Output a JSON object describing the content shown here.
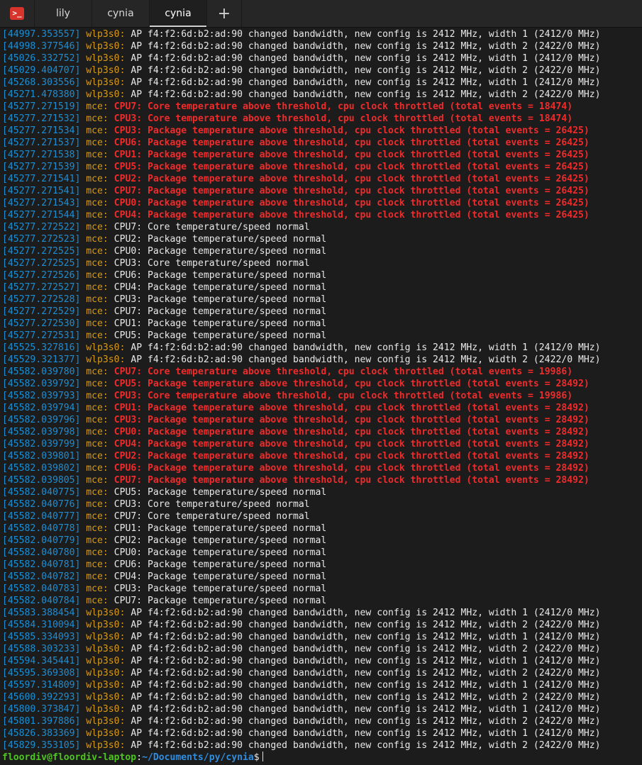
{
  "tabs": [
    {
      "label": "lily",
      "active": false
    },
    {
      "label": "cynia",
      "active": false
    },
    {
      "label": "cynia",
      "active": true
    }
  ],
  "tab_icon": "terminal-icon",
  "add_tab_icon": "plus-icon",
  "colors": {
    "background": "#1c1c1c",
    "timestamp": "#1a8fd6",
    "source": "#d89a18",
    "alert": "#ef2b2b",
    "text": "#e9e9e9",
    "prompt_user": "#4ec521",
    "prompt_path": "#2f8de0",
    "app_icon": "#d9342b"
  },
  "lines": [
    {
      "ts": "[44997.353557]",
      "src": "wlp3s0:",
      "msg": " AP f4:f2:6d:b2:ad:90 changed bandwidth, new config is 2412 MHz, width 1 (2412/0 MHz)"
    },
    {
      "ts": "[44998.377546]",
      "src": "wlp3s0:",
      "msg": " AP f4:f2:6d:b2:ad:90 changed bandwidth, new config is 2412 MHz, width 2 (2422/0 MHz)"
    },
    {
      "ts": "[45026.332752]",
      "src": "wlp3s0:",
      "msg": " AP f4:f2:6d:b2:ad:90 changed bandwidth, new config is 2412 MHz, width 1 (2412/0 MHz)"
    },
    {
      "ts": "[45029.404707]",
      "src": "wlp3s0:",
      "msg": " AP f4:f2:6d:b2:ad:90 changed bandwidth, new config is 2412 MHz, width 2 (2422/0 MHz)"
    },
    {
      "ts": "[45268.303556]",
      "src": "wlp3s0:",
      "msg": " AP f4:f2:6d:b2:ad:90 changed bandwidth, new config is 2412 MHz, width 1 (2412/0 MHz)"
    },
    {
      "ts": "[45271.478380]",
      "src": "wlp3s0:",
      "msg": " AP f4:f2:6d:b2:ad:90 changed bandwidth, new config is 2412 MHz, width 2 (2422/0 MHz)"
    },
    {
      "ts": "[45277.271519]",
      "src": "mce:",
      "msg": " CPU7: Core temperature above threshold, cpu clock throttled (total events = 18474)",
      "alert": true
    },
    {
      "ts": "[45277.271532]",
      "src": "mce:",
      "msg": " CPU3: Core temperature above threshold, cpu clock throttled (total events = 18474)",
      "alert": true
    },
    {
      "ts": "[45277.271534]",
      "src": "mce:",
      "msg": " CPU3: Package temperature above threshold, cpu clock throttled (total events = 26425)",
      "alert": true
    },
    {
      "ts": "[45277.271537]",
      "src": "mce:",
      "msg": " CPU6: Package temperature above threshold, cpu clock throttled (total events = 26425)",
      "alert": true
    },
    {
      "ts": "[45277.271538]",
      "src": "mce:",
      "msg": " CPU1: Package temperature above threshold, cpu clock throttled (total events = 26425)",
      "alert": true
    },
    {
      "ts": "[45277.271539]",
      "src": "mce:",
      "msg": " CPU5: Package temperature above threshold, cpu clock throttled (total events = 26425)",
      "alert": true
    },
    {
      "ts": "[45277.271541]",
      "src": "mce:",
      "msg": " CPU2: Package temperature above threshold, cpu clock throttled (total events = 26425)",
      "alert": true
    },
    {
      "ts": "[45277.271541]",
      "src": "mce:",
      "msg": " CPU7: Package temperature above threshold, cpu clock throttled (total events = 26425)",
      "alert": true
    },
    {
      "ts": "[45277.271543]",
      "src": "mce:",
      "msg": " CPU0: Package temperature above threshold, cpu clock throttled (total events = 26425)",
      "alert": true
    },
    {
      "ts": "[45277.271544]",
      "src": "mce:",
      "msg": " CPU4: Package temperature above threshold, cpu clock throttled (total events = 26425)",
      "alert": true
    },
    {
      "ts": "[45277.272522]",
      "src": "mce:",
      "msg": " CPU7: Core temperature/speed normal"
    },
    {
      "ts": "[45277.272523]",
      "src": "mce:",
      "msg": " CPU2: Package temperature/speed normal"
    },
    {
      "ts": "[45277.272525]",
      "src": "mce:",
      "msg": " CPU0: Package temperature/speed normal"
    },
    {
      "ts": "[45277.272525]",
      "src": "mce:",
      "msg": " CPU3: Core temperature/speed normal"
    },
    {
      "ts": "[45277.272526]",
      "src": "mce:",
      "msg": " CPU6: Package temperature/speed normal"
    },
    {
      "ts": "[45277.272527]",
      "src": "mce:",
      "msg": " CPU4: Package temperature/speed normal"
    },
    {
      "ts": "[45277.272528]",
      "src": "mce:",
      "msg": " CPU3: Package temperature/speed normal"
    },
    {
      "ts": "[45277.272529]",
      "src": "mce:",
      "msg": " CPU7: Package temperature/speed normal"
    },
    {
      "ts": "[45277.272530]",
      "src": "mce:",
      "msg": " CPU1: Package temperature/speed normal"
    },
    {
      "ts": "[45277.272531]",
      "src": "mce:",
      "msg": " CPU5: Package temperature/speed normal"
    },
    {
      "ts": "[45525.327816]",
      "src": "wlp3s0:",
      "msg": " AP f4:f2:6d:b2:ad:90 changed bandwidth, new config is 2412 MHz, width 1 (2412/0 MHz)"
    },
    {
      "ts": "[45529.321377]",
      "src": "wlp3s0:",
      "msg": " AP f4:f2:6d:b2:ad:90 changed bandwidth, new config is 2412 MHz, width 2 (2422/0 MHz)"
    },
    {
      "ts": "[45582.039780]",
      "src": "mce:",
      "msg": " CPU7: Core temperature above threshold, cpu clock throttled (total events = 19986)",
      "alert": true
    },
    {
      "ts": "[45582.039792]",
      "src": "mce:",
      "msg": " CPU5: Package temperature above threshold, cpu clock throttled (total events = 28492)",
      "alert": true
    },
    {
      "ts": "[45582.039793]",
      "src": "mce:",
      "msg": " CPU3: Core temperature above threshold, cpu clock throttled (total events = 19986)",
      "alert": true
    },
    {
      "ts": "[45582.039794]",
      "src": "mce:",
      "msg": " CPU1: Package temperature above threshold, cpu clock throttled (total events = 28492)",
      "alert": true
    },
    {
      "ts": "[45582.039796]",
      "src": "mce:",
      "msg": " CPU3: Package temperature above threshold, cpu clock throttled (total events = 28492)",
      "alert": true
    },
    {
      "ts": "[45582.039798]",
      "src": "mce:",
      "msg": " CPU0: Package temperature above threshold, cpu clock throttled (total events = 28492)",
      "alert": true
    },
    {
      "ts": "[45582.039799]",
      "src": "mce:",
      "msg": " CPU4: Package temperature above threshold, cpu clock throttled (total events = 28492)",
      "alert": true
    },
    {
      "ts": "[45582.039801]",
      "src": "mce:",
      "msg": " CPU2: Package temperature above threshold, cpu clock throttled (total events = 28492)",
      "alert": true
    },
    {
      "ts": "[45582.039802]",
      "src": "mce:",
      "msg": " CPU6: Package temperature above threshold, cpu clock throttled (total events = 28492)",
      "alert": true
    },
    {
      "ts": "[45582.039805]",
      "src": "mce:",
      "msg": " CPU7: Package temperature above threshold, cpu clock throttled (total events = 28492)",
      "alert": true
    },
    {
      "ts": "[45582.040775]",
      "src": "mce:",
      "msg": " CPU5: Package temperature/speed normal"
    },
    {
      "ts": "[45582.040776]",
      "src": "mce:",
      "msg": " CPU3: Core temperature/speed normal"
    },
    {
      "ts": "[45582.040777]",
      "src": "mce:",
      "msg": " CPU7: Core temperature/speed normal"
    },
    {
      "ts": "[45582.040778]",
      "src": "mce:",
      "msg": " CPU1: Package temperature/speed normal"
    },
    {
      "ts": "[45582.040779]",
      "src": "mce:",
      "msg": " CPU2: Package temperature/speed normal"
    },
    {
      "ts": "[45582.040780]",
      "src": "mce:",
      "msg": " CPU0: Package temperature/speed normal"
    },
    {
      "ts": "[45582.040781]",
      "src": "mce:",
      "msg": " CPU6: Package temperature/speed normal"
    },
    {
      "ts": "[45582.040782]",
      "src": "mce:",
      "msg": " CPU4: Package temperature/speed normal"
    },
    {
      "ts": "[45582.040783]",
      "src": "mce:",
      "msg": " CPU3: Package temperature/speed normal"
    },
    {
      "ts": "[45582.040784]",
      "src": "mce:",
      "msg": " CPU7: Package temperature/speed normal"
    },
    {
      "ts": "[45583.388454]",
      "src": "wlp3s0:",
      "msg": " AP f4:f2:6d:b2:ad:90 changed bandwidth, new config is 2412 MHz, width 1 (2412/0 MHz)"
    },
    {
      "ts": "[45584.310094]",
      "src": "wlp3s0:",
      "msg": " AP f4:f2:6d:b2:ad:90 changed bandwidth, new config is 2412 MHz, width 2 (2422/0 MHz)"
    },
    {
      "ts": "[45585.334093]",
      "src": "wlp3s0:",
      "msg": " AP f4:f2:6d:b2:ad:90 changed bandwidth, new config is 2412 MHz, width 1 (2412/0 MHz)"
    },
    {
      "ts": "[45588.303233]",
      "src": "wlp3s0:",
      "msg": " AP f4:f2:6d:b2:ad:90 changed bandwidth, new config is 2412 MHz, width 2 (2422/0 MHz)"
    },
    {
      "ts": "[45594.345441]",
      "src": "wlp3s0:",
      "msg": " AP f4:f2:6d:b2:ad:90 changed bandwidth, new config is 2412 MHz, width 1 (2412/0 MHz)"
    },
    {
      "ts": "[45595.369308]",
      "src": "wlp3s0:",
      "msg": " AP f4:f2:6d:b2:ad:90 changed bandwidth, new config is 2412 MHz, width 2 (2422/0 MHz)"
    },
    {
      "ts": "[45597.314809]",
      "src": "wlp3s0:",
      "msg": " AP f4:f2:6d:b2:ad:90 changed bandwidth, new config is 2412 MHz, width 1 (2412/0 MHz)"
    },
    {
      "ts": "[45600.392293]",
      "src": "wlp3s0:",
      "msg": " AP f4:f2:6d:b2:ad:90 changed bandwidth, new config is 2412 MHz, width 2 (2422/0 MHz)"
    },
    {
      "ts": "[45800.373847]",
      "src": "wlp3s0:",
      "msg": " AP f4:f2:6d:b2:ad:90 changed bandwidth, new config is 2412 MHz, width 1 (2412/0 MHz)"
    },
    {
      "ts": "[45801.397886]",
      "src": "wlp3s0:",
      "msg": " AP f4:f2:6d:b2:ad:90 changed bandwidth, new config is 2412 MHz, width 2 (2422/0 MHz)"
    },
    {
      "ts": "[45826.383369]",
      "src": "wlp3s0:",
      "msg": " AP f4:f2:6d:b2:ad:90 changed bandwidth, new config is 2412 MHz, width 1 (2412/0 MHz)"
    },
    {
      "ts": "[45829.353105]",
      "src": "wlp3s0:",
      "msg": " AP f4:f2:6d:b2:ad:90 changed bandwidth, new config is 2412 MHz, width 2 (2422/0 MHz)"
    }
  ],
  "prompt": {
    "user_host": "floordiv@floordiv-laptop",
    "separator": ":",
    "path": "~/Documents/py/cynia",
    "symbol": "$"
  }
}
